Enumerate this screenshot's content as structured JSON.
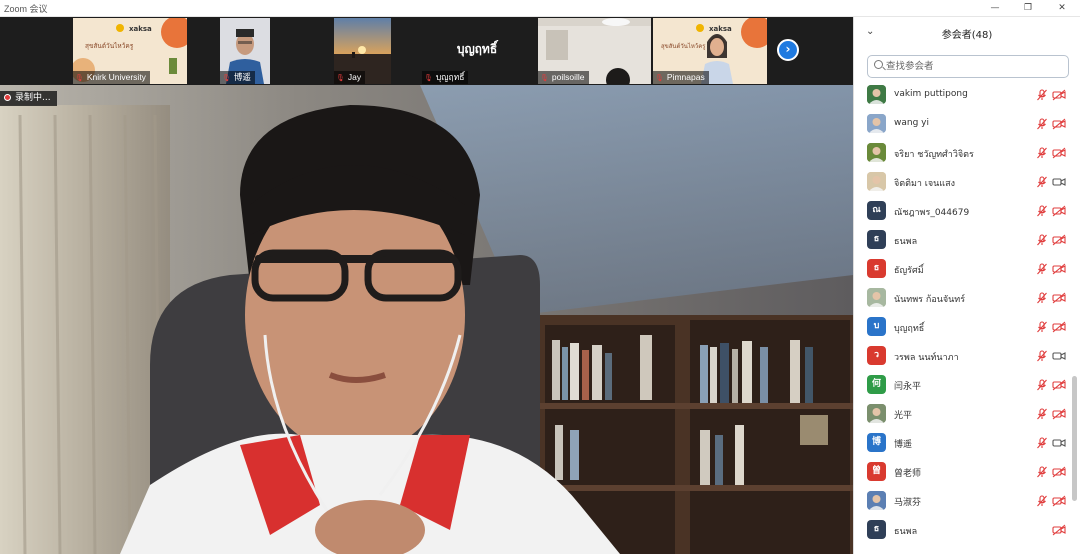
{
  "window": {
    "title": "Zoom 会议",
    "minimize": "—",
    "restore": "❐",
    "close": "✕"
  },
  "strip": {
    "thumbs": [
      {
        "name": "Knirk University",
        "type": "slide"
      },
      {
        "name": "博遥",
        "type": "person"
      },
      {
        "name": "Jay",
        "type": "sunset"
      },
      {
        "name": "บุญฤทธิ์",
        "type": "text",
        "display": "บุญฤทธิ์"
      },
      {
        "name": "poilsoille",
        "type": "room"
      },
      {
        "name": "Pimnapas",
        "type": "slide-person"
      }
    ],
    "next_icon": "›"
  },
  "main": {
    "recording_label": "录制中..."
  },
  "participants": {
    "title": "参会者(48)",
    "collapse_icon": "⌄",
    "search_placeholder": "查找参会者",
    "list": [
      {
        "name": "vakim puttipong",
        "initial": "",
        "color": "#3f7a45",
        "kind": "photo",
        "cam": "off"
      },
      {
        "name": "wang yi",
        "initial": "",
        "color": "#8aa6c9",
        "kind": "photo",
        "cam": "off"
      },
      {
        "name": "จริยา ชวัญทศำวิจิตร",
        "initial": "",
        "color": "#6a8a3a",
        "kind": "photo",
        "cam": "off"
      },
      {
        "name": "จิตติมา เจนแสง",
        "initial": "",
        "color": "#d8c7a8",
        "kind": "photo",
        "cam": "on"
      },
      {
        "name": "ณัชฎาพร_044679",
        "initial": "ณ",
        "color": "#2f3f57",
        "kind": "letter",
        "cam": "off"
      },
      {
        "name": "ธนพล",
        "initial": "ธ",
        "color": "#2f3f57",
        "kind": "letter",
        "cam": "off"
      },
      {
        "name": "ธัญรัศมิ์",
        "initial": "ธ",
        "color": "#d93a2f",
        "kind": "letter",
        "cam": "off"
      },
      {
        "name": "นันทพร ก้อนจันทร์",
        "initial": "",
        "color": "#a7b8a0",
        "kind": "photo",
        "cam": "off"
      },
      {
        "name": "บุญฤทธิ์",
        "initial": "บ",
        "color": "#2a74c9",
        "kind": "letter",
        "cam": "off"
      },
      {
        "name": "วรพล นนท์นาภา",
        "initial": "ว",
        "color": "#d93a2f",
        "kind": "letter",
        "cam": "on"
      },
      {
        "name": "闫永平",
        "initial": "何",
        "color": "#2f9c48",
        "kind": "letter",
        "cam": "off"
      },
      {
        "name": "光平",
        "initial": "",
        "color": "#7b8f6d",
        "kind": "photo",
        "cam": "off"
      },
      {
        "name": "博遥",
        "initial": "博",
        "color": "#2a74c9",
        "kind": "letter",
        "cam": "on"
      },
      {
        "name": "曾老师",
        "initial": "曾",
        "color": "#d93a2f",
        "kind": "letter",
        "cam": "off"
      },
      {
        "name": "马淑芬",
        "initial": "",
        "color": "#5b7fb3",
        "kind": "photo",
        "cam": "off"
      },
      {
        "name": "ธนพล",
        "initial": "ธ",
        "color": "#2f3f57",
        "kind": "letter",
        "cam": "none"
      }
    ]
  },
  "colors": {
    "muted_red": "#e03c3c",
    "accent_blue": "#1f7ae0"
  }
}
